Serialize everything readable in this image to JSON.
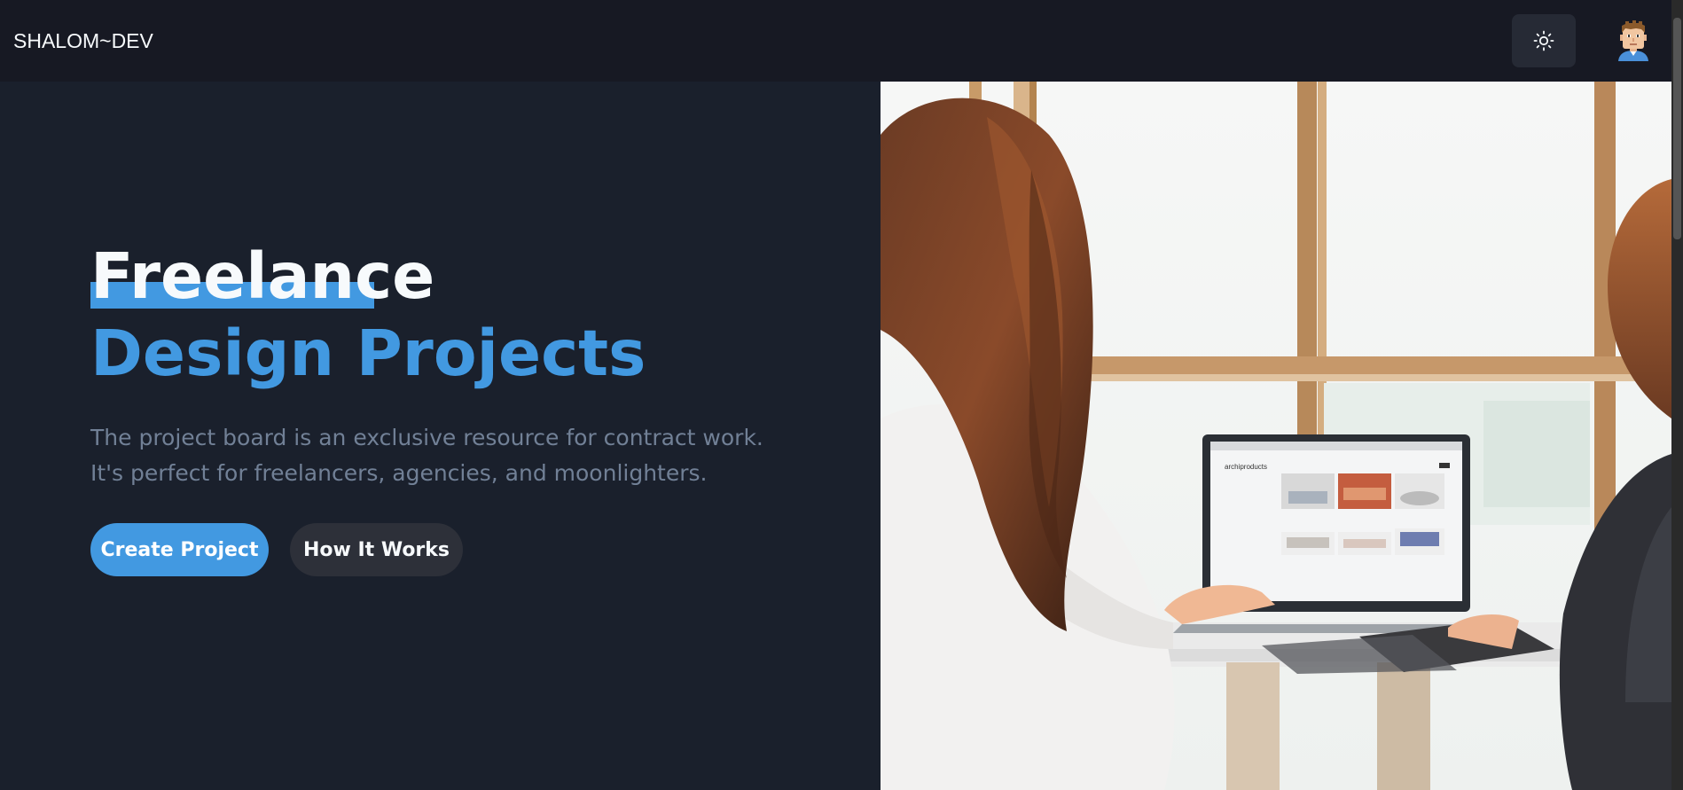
{
  "navbar": {
    "brand": "SHALOM~DEV",
    "theme_toggle_icon": "sun-icon",
    "avatar_icon": "avatar-icon"
  },
  "hero": {
    "heading_line1": "Freelance",
    "heading_line2": "Design Projects",
    "description": "The project board is an exclusive resource for contract work. It's perfect for freelancers, agencies, and moonlighters.",
    "primary_button": "Create Project",
    "secondary_button": "How It Works",
    "image_icon": "hero-photo",
    "laptop_screen_title": "archiproducts"
  },
  "colors": {
    "accent": "#4299e1",
    "background": "#1a202c",
    "navbar": "#171923",
    "text_muted": "#718096",
    "text_light": "#f7fafc"
  }
}
